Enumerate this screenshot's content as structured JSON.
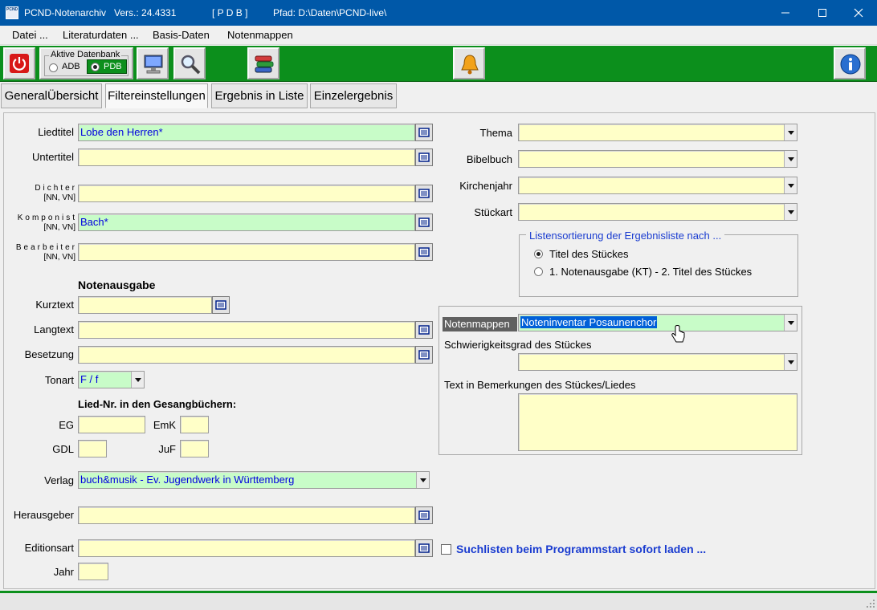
{
  "window": {
    "app_icon_text": "PCND",
    "title": "PCND-Notenarchiv",
    "version": "Vers.: 24.4331",
    "db_tag": "[ P D B ]",
    "path": "Pfad: D:\\Daten\\PCND-live\\"
  },
  "menu": [
    "Datei ...",
    "Literaturdaten ...",
    "Basis-Daten",
    "Notenmappen"
  ],
  "toolbar": {
    "db_group_label": "Aktive Datenbank",
    "db_options": [
      "ADB",
      "PDB"
    ],
    "db_selected": "PDB"
  },
  "tabs": [
    "GeneralÜbersicht",
    "Filtereinstellungen",
    "Ergebnis in Liste",
    "Einzelergebnis"
  ],
  "active_tab": "Filtereinstellungen",
  "form": {
    "liedtitel": {
      "label": "Liedtitel",
      "value": "Lobe den Herren*"
    },
    "untertitel": {
      "label": "Untertitel",
      "value": ""
    },
    "dichter": {
      "label": "Dichter",
      "sub": "[NN, VN]",
      "value": ""
    },
    "komponist": {
      "label": "Komponist",
      "sub": "[NN, VN]",
      "value": "Bach*"
    },
    "bearbeiter": {
      "label": "Bearbeiter",
      "sub": "[NN, VN]",
      "value": ""
    },
    "notenausgabe_header": "Notenausgabe",
    "kurztext": {
      "label": "Kurztext",
      "value": ""
    },
    "langtext": {
      "label": "Langtext",
      "value": ""
    },
    "besetzung": {
      "label": "Besetzung",
      "value": ""
    },
    "tonart": {
      "label": "Tonart",
      "value": "F / f"
    },
    "lied_nr_header": "Lied-Nr. in den Gesangbüchern:",
    "eg": {
      "label": "EG",
      "value": ""
    },
    "emk": {
      "label": "EmK",
      "value": ""
    },
    "gdl": {
      "label": "GDL",
      "value": ""
    },
    "juf": {
      "label": "JuF",
      "value": ""
    },
    "verlag": {
      "label": "Verlag",
      "value": "buch&musik - Ev. Jugendwerk in Württemberg"
    },
    "herausgeber": {
      "label": "Herausgeber",
      "value": ""
    },
    "editionsart": {
      "label": "Editionsart",
      "value": ""
    },
    "jahr": {
      "label": "Jahr",
      "value": ""
    },
    "thema": {
      "label": "Thema",
      "value": ""
    },
    "bibelbuch": {
      "label": "Bibelbuch",
      "value": ""
    },
    "kirchenjahr": {
      "label": "Kirchenjahr",
      "value": ""
    },
    "stueckart": {
      "label": "Stückart",
      "value": ""
    },
    "sort_group": {
      "title": "Listensortierung der Ergebnisliste  nach ...",
      "options": [
        "Titel des Stückes",
        "1. Notenausgabe (KT) - 2. Titel des Stückes"
      ],
      "selected": "Titel des Stückes"
    },
    "notenmappen": {
      "label": "Notenmappen",
      "value": "Noteninventar Posaunenchor"
    },
    "schwierigkeit_label": "Schwierigkeitsgrad des Stückes",
    "schwierigkeit_value": "",
    "bemerkung_label": "Text in Bemerkungen des Stückes/Liedes",
    "bemerkung_value": "",
    "autoload": {
      "label": "Suchlisten beim Programmstart sofort laden ...",
      "checked": false
    }
  },
  "colors": {
    "titlebar": "#0058a8",
    "toolbar": "#0c8f1c",
    "field_yellow": "#ffffc8",
    "field_green": "#c8fcc8",
    "value_blue": "#0000e0"
  }
}
